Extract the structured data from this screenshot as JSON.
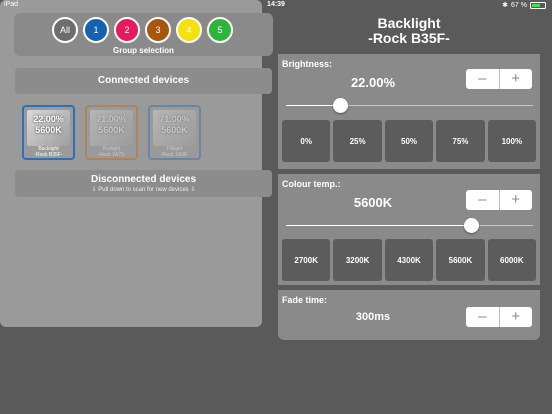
{
  "status_bar": {
    "carrier": "iPad",
    "time": "14:39",
    "battery": "67 %",
    "battery_level": 0.67
  },
  "groups": {
    "label": "Group selection",
    "buttons": [
      {
        "label": "All",
        "color": "#6d6d6d"
      },
      {
        "label": "1",
        "color": "#1562b0"
      },
      {
        "label": "2",
        "color": "#e8195d"
      },
      {
        "label": "3",
        "color": "#a8560c"
      },
      {
        "label": "4",
        "color": "#f4e20c"
      },
      {
        "label": "5",
        "color": "#2db53a"
      }
    ]
  },
  "connected_label": "Connected devices",
  "devices": [
    {
      "value_top": "22.00%",
      "value_bottom": "5600K",
      "name_line1": "Backlight",
      "name_line2": "-Rock B35F-",
      "border": "#2f6fb5",
      "dim": false
    },
    {
      "value_top": "71.00%",
      "value_bottom": "5600K",
      "name_line1": "Keylight",
      "name_line2": "-Rock 3A70-",
      "border": "#c86a1a",
      "dim": true
    },
    {
      "value_top": "71.00%",
      "value_bottom": "5600K",
      "name_line1": "Filllight",
      "name_line2": "-Rock 1A38-",
      "border": "#2f6fb5",
      "dim": true
    }
  ],
  "disconnected": {
    "label": "Disconnected devices",
    "hint": "⇩ Pull down to scan for new devices ⇩"
  },
  "detail": {
    "title_line1": "Backlight",
    "title_line2": "-Rock B35F-",
    "brightness": {
      "label": "Brightness:",
      "value": "22.00%",
      "level": 0.22,
      "presets": [
        "0%",
        "25%",
        "50%",
        "75%",
        "100%"
      ]
    },
    "colour_temp": {
      "label": "Colour temp.:",
      "value": "5600K",
      "level": 0.75,
      "presets": [
        "2700K",
        "3200K",
        "4300K",
        "5600K",
        "6000K"
      ]
    },
    "fade": {
      "label": "Fade time:",
      "value": "300ms"
    },
    "stepper": {
      "minus": "–",
      "plus": "+"
    }
  }
}
